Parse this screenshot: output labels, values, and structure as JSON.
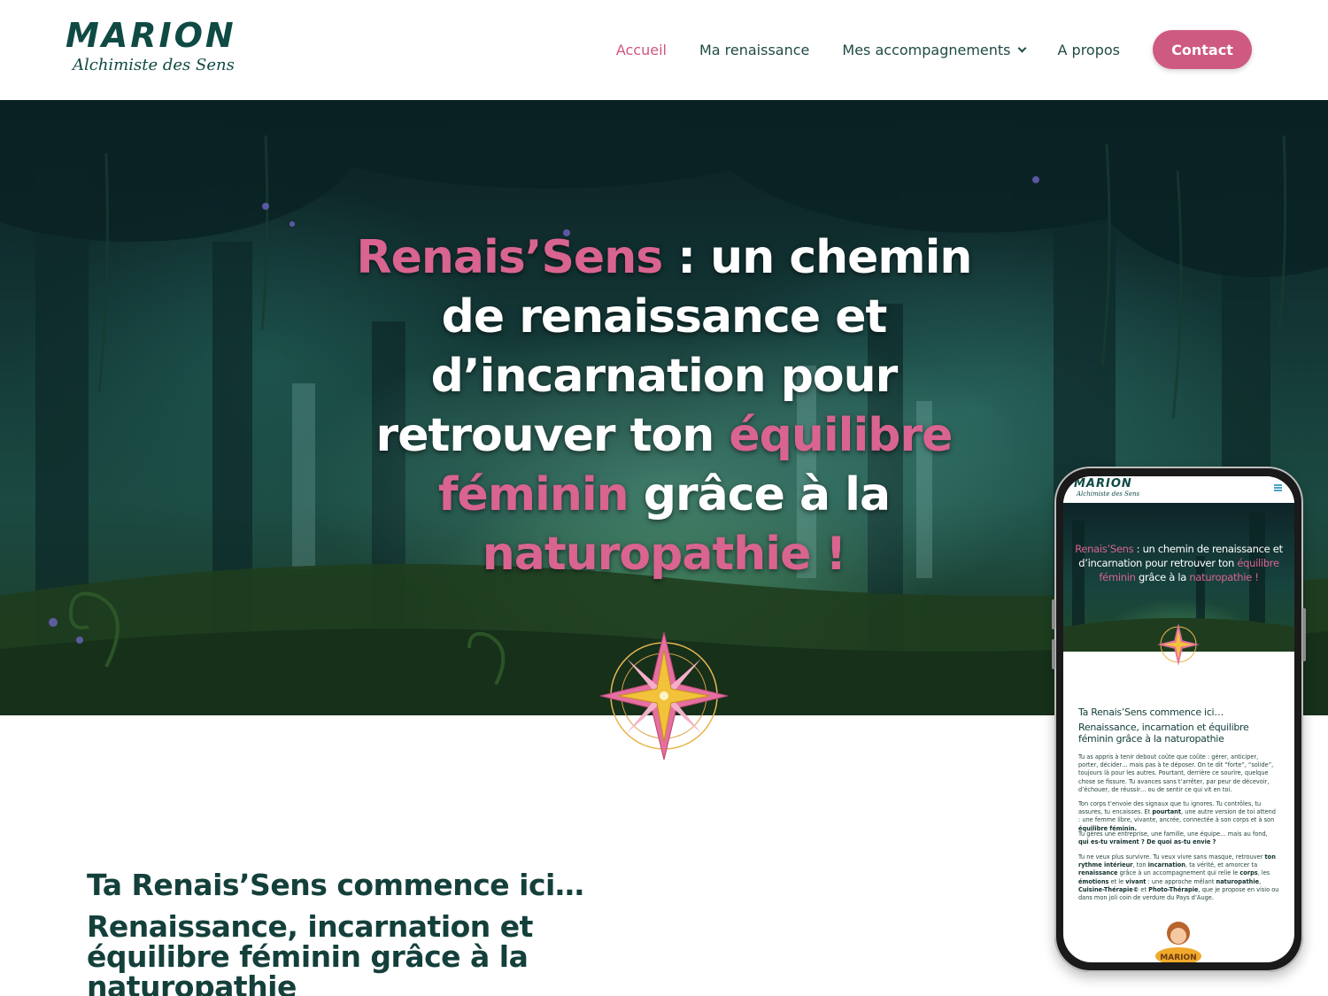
{
  "header": {
    "logo_name": "MARION",
    "logo_tagline": "Alchimiste des Sens",
    "nav": [
      {
        "label": "Accueil",
        "active": true
      },
      {
        "label": "Ma renaissance",
        "active": false
      },
      {
        "label": "Mes accompagnements",
        "active": false,
        "has_dropdown": true
      },
      {
        "label": "A propos",
        "active": false
      }
    ],
    "contact_label": "Contact"
  },
  "hero": {
    "title_parts": [
      {
        "text": "Renais’Sens",
        "accent": true
      },
      {
        "text": " : un chemin de renaissance et d’incarnation pour retrouver ton ",
        "accent": false
      },
      {
        "text": "équilibre féminin",
        "accent": true
      },
      {
        "text": " grâce à la ",
        "accent": false
      },
      {
        "text": "naturopathie !",
        "accent": true
      }
    ]
  },
  "intro": {
    "heading": "Ta Renais’Sens commence ici…",
    "subheading": "Renaissance, incarnation et équilibre féminin grâce à la naturopathie"
  },
  "mobile": {
    "logo_name": "MARION",
    "logo_tagline": "Alchimiste des Sens",
    "hero_title_parts": [
      {
        "text": "Renais’Sens",
        "accent": true
      },
      {
        "text": " : un chemin de renaissance et d’incarnation pour retrouver ton ",
        "accent": false
      },
      {
        "text": "équilibre féminin",
        "accent": true
      },
      {
        "text": " grâce à la ",
        "accent": false
      },
      {
        "text": "naturopathie",
        "accent": true
      },
      {
        "text": " !",
        "accent": true
      }
    ],
    "intro_heading": "Ta Renais’Sens commence ici…",
    "intro_subheading": "Renaissance, incarnation et équilibre féminin grâce à la naturopathie",
    "paragraphs": [
      [
        {
          "text": "Tu as appris à tenir debout coûte que coûte : gérer, anticiper, porter, décider… mais pas à te déposer. On te dit “forte”, “solide”, toujours là pour les autres. Pourtant, derrière ce sourire, quelque chose se fissure. Tu avances sans t’arrêter, par peur de décevoir, d’échouer, de réussir… ou de sentir ce qui vit en toi.",
          "bold": false
        }
      ],
      [
        {
          "text": "Ton corps t’envoie des signaux que tu ignores. Tu contrôles, tu assures, tu encaisses. Et ",
          "bold": false
        },
        {
          "text": "pourtant",
          "bold": true
        },
        {
          "text": ", une autre version de toi attend : une femme libre, vivante, ancrée, connectée à son corps et à son ",
          "bold": false
        },
        {
          "text": "équilibre féminin.",
          "bold": true
        }
      ],
      [
        {
          "text": "Tu gères une entreprise, une famille, une équipe… mais au fond, ",
          "bold": false
        },
        {
          "text": "qui es-tu vraiment ? De quoi as-tu envie ?",
          "bold": true
        }
      ],
      [
        {
          "text": "Tu ne veux plus survivre. Tu veux vivre sans masque, retrouver ",
          "bold": false
        },
        {
          "text": "ton rythme intérieur",
          "bold": true
        },
        {
          "text": ", ton ",
          "bold": false
        },
        {
          "text": "incarnation",
          "bold": true
        },
        {
          "text": ", ta vérité, et amorcer ta ",
          "bold": false
        },
        {
          "text": "renaissance",
          "bold": true
        },
        {
          "text": " grâce à un accompagnement qui relie le ",
          "bold": false
        },
        {
          "text": "corps",
          "bold": true
        },
        {
          "text": ", les ",
          "bold": false
        },
        {
          "text": "émotions",
          "bold": true
        },
        {
          "text": " et le ",
          "bold": false
        },
        {
          "text": "vivant",
          "bold": true
        },
        {
          "text": " : une approche mêlant ",
          "bold": false
        },
        {
          "text": "naturopathie",
          "bold": true
        },
        {
          "text": ", ",
          "bold": false
        },
        {
          "text": "Cuisine-Thérapie©",
          "bold": true
        },
        {
          "text": " et ",
          "bold": false
        },
        {
          "text": "Photo-Thérapie",
          "bold": true
        },
        {
          "text": ", que je propose en visio ou dans mon joli coin de verdure du Pays d’Auge.",
          "bold": false
        }
      ]
    ],
    "mascot_label": "MARION"
  },
  "colors": {
    "accent_pink": "#d0567f",
    "brand_green": "#0f4a44",
    "hero_green": "#17433f",
    "compass_gold": "#f2c23a"
  },
  "icons": [
    "compass-star-icon",
    "chevron-down-icon",
    "hamburger-menu-icon"
  ]
}
